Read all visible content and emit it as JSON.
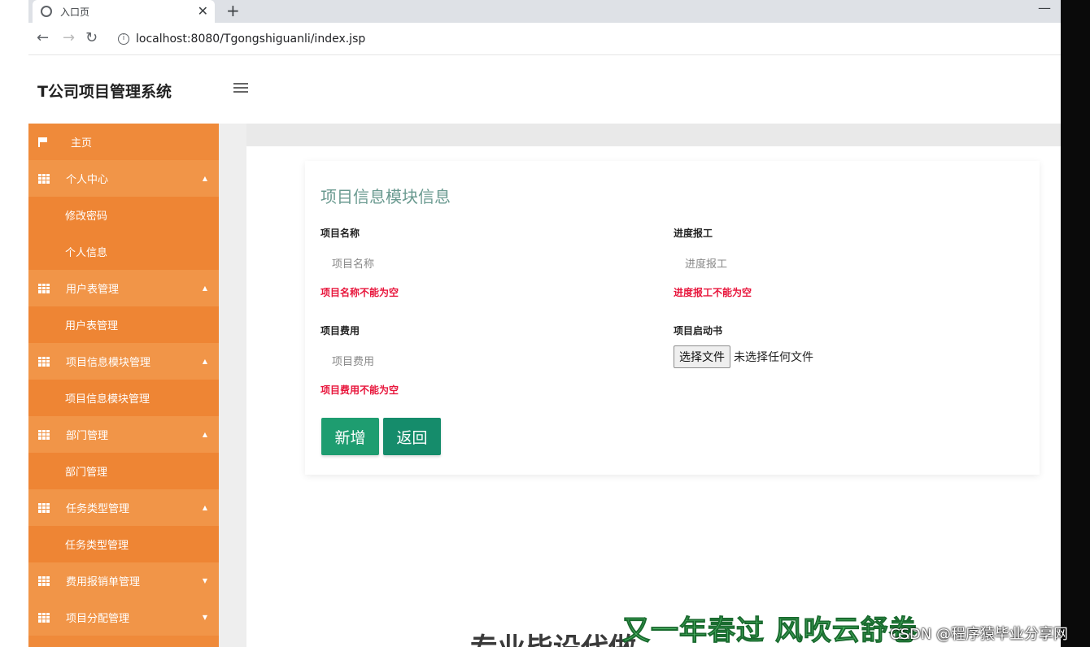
{
  "browser": {
    "tab_title": "入口页",
    "close_glyph": "✕",
    "new_tab_glyph": "+",
    "minimize_glyph": "—",
    "url": "localhost:8080/Tgongshiguanli/index.jsp",
    "info_glyph": "i",
    "back_glyph": "←",
    "forward_glyph": "→",
    "reload_glyph": "↻"
  },
  "header": {
    "title": "T公司项目管理系统"
  },
  "sidebar": {
    "items": [
      {
        "label": "主页",
        "type": "home",
        "icon": "flag-icon"
      },
      {
        "label": "个人中心",
        "type": "parent",
        "icon": "grid-icon"
      },
      {
        "label": "修改密码",
        "type": "child"
      },
      {
        "label": "个人信息",
        "type": "child"
      },
      {
        "label": "用户表管理",
        "type": "parent",
        "icon": "grid-icon"
      },
      {
        "label": "用户表管理",
        "type": "child"
      },
      {
        "label": "项目信息模块管理",
        "type": "parent",
        "icon": "grid-icon"
      },
      {
        "label": "项目信息模块管理",
        "type": "child"
      },
      {
        "label": "部门管理",
        "type": "parent",
        "icon": "grid-icon"
      },
      {
        "label": "部门管理",
        "type": "child"
      },
      {
        "label": "任务类型管理",
        "type": "parent",
        "icon": "grid-icon"
      },
      {
        "label": "任务类型管理",
        "type": "child"
      },
      {
        "label": "费用报销单管理",
        "type": "parent",
        "icon": "grid-icon"
      },
      {
        "label": "项目分配管理",
        "type": "parent",
        "icon": "grid-icon"
      }
    ],
    "caret_glyph": "▲",
    "caret_down_glyph": "▼"
  },
  "form": {
    "title": "项目信息模块信息",
    "name_label": "项目名称",
    "name_placeholder": "项目名称",
    "name_error": "项目名称不能为空",
    "progress_label": "进度报工",
    "progress_placeholder": "进度报工",
    "progress_error": "进度报工不能为空",
    "cost_label": "项目费用",
    "cost_placeholder": "项目费用",
    "cost_error": "项目费用不能为空",
    "doc_label": "项目启动书",
    "file_button": "选择文件",
    "file_status": "未选择任何文件",
    "add_button": "新增",
    "back_button": "返回"
  },
  "overlay": {
    "green_text": "又一年春过 风吹云舒卷",
    "dark_text": "专业毕设代做",
    "watermark": "CSDN @程序猿毕业分享网"
  },
  "colors": {
    "sidebar": "#ef8a3a",
    "accent_green": "#1e9d70",
    "error_red": "#e8163c",
    "title_teal": "#6a9a90"
  }
}
